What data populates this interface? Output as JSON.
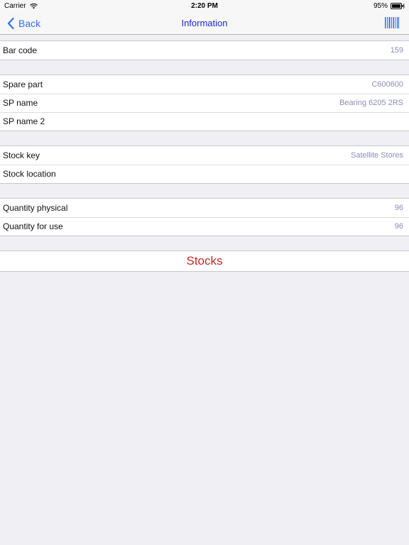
{
  "status_bar": {
    "carrier": "Carrier",
    "time": "2:20 PM",
    "battery": "95%"
  },
  "nav": {
    "back_label": "Back",
    "title": "Information"
  },
  "sections": [
    {
      "rows": [
        {
          "label": "Bar code",
          "value": "159"
        }
      ]
    },
    {
      "rows": [
        {
          "label": "Spare part",
          "value": "C600600"
        },
        {
          "label": "SP name",
          "value": "Bearing 6205 2RS"
        },
        {
          "label": "SP name 2",
          "value": ""
        }
      ]
    },
    {
      "rows": [
        {
          "label": "Stock key",
          "value": "Satellite Stores"
        },
        {
          "label": "Stock location",
          "value": ""
        }
      ]
    },
    {
      "rows": [
        {
          "label": "Quantity physical",
          "value": "96"
        },
        {
          "label": "Quantity for use",
          "value": "96"
        }
      ]
    }
  ],
  "stocks_button": {
    "label": "Stocks"
  },
  "colors": {
    "accent": "#2f6fe8",
    "title": "#1b29d6",
    "value": "#8b8bb8",
    "action": "#c1262a",
    "background": "#efeff4"
  },
  "icons": {
    "back": "chevron-left-icon",
    "barcode": "barcode-icon",
    "wifi": "wifi-icon",
    "battery": "battery-icon"
  }
}
